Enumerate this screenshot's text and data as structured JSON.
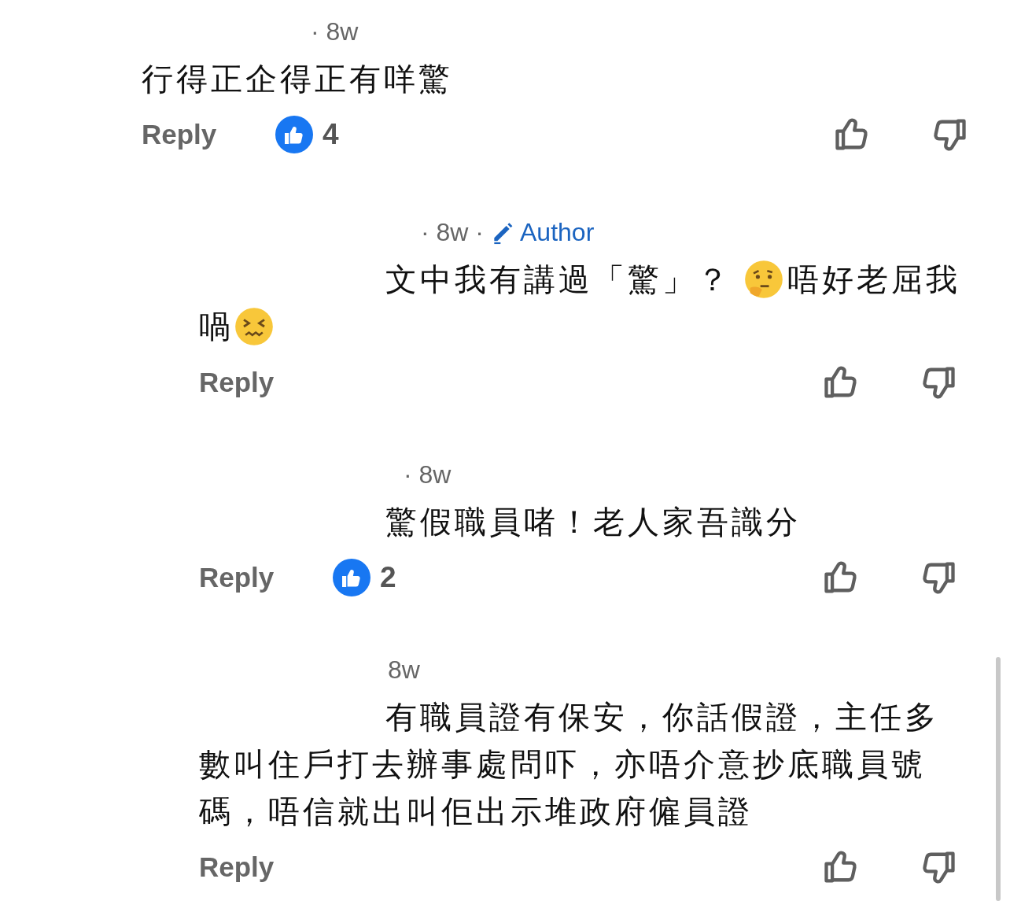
{
  "comments": [
    {
      "kind": "comment",
      "time": "· 8w",
      "body": [
        {
          "kind": "text",
          "text": "行得正企得正有咩驚"
        }
      ],
      "reply": "Reply",
      "likes": "4",
      "liked": true
    },
    {
      "kind": "reply",
      "time": "· 8w ·",
      "author_label": "Author",
      "body": [
        {
          "kind": "text",
          "text": "文中我有講過「驚」？ "
        },
        {
          "kind": "thinking"
        },
        {
          "kind": "text",
          "text": "唔好老屈我喎"
        },
        {
          "kind": "wincing"
        }
      ],
      "reply": "Reply"
    },
    {
      "kind": "reply",
      "time": "· 8w",
      "body": [
        {
          "kind": "text",
          "text": "驚假職員啫！老人家吾識分"
        }
      ],
      "reply": "Reply",
      "likes": "2",
      "liked": true
    },
    {
      "kind": "reply",
      "time": "8w",
      "body": [
        {
          "kind": "text",
          "text": "有職員證有保安，你話假證，主任多數叫住戶打去辦事處問吓，亦唔介意抄底職員號碼，唔信就出叫佢出示堆政府僱員證"
        }
      ],
      "reply": "Reply"
    }
  ]
}
